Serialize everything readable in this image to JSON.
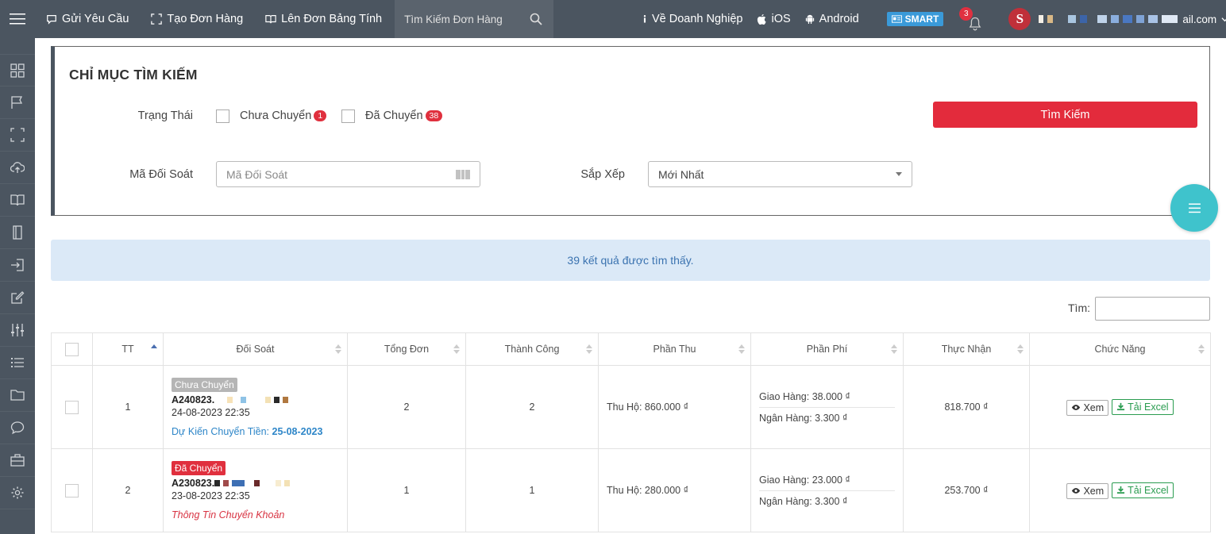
{
  "topbar": {
    "nav": [
      {
        "label": "Gửi Yêu Cầu",
        "icon": "chat-icon"
      },
      {
        "label": "Tạo Đơn Hàng",
        "icon": "scan-icon"
      },
      {
        "label": "Lên Đơn Bảng Tính",
        "icon": "book-icon"
      }
    ],
    "search_placeholder": "Tìm Kiếm Đơn Hàng",
    "about": "Về Doanh Nghiệp",
    "ios": "iOS",
    "android": "Android",
    "smart": "SMART",
    "notification_count": "3",
    "avatar_letter": "S",
    "email_suffix": "ail.com"
  },
  "filter": {
    "title": "CHỈ MỤC TÌM KIẾM",
    "status_label": "Trạng Thái",
    "option_pending": "Chưa Chuyển",
    "option_pending_count": "1",
    "option_done": "Đã Chuyển",
    "option_done_count": "38",
    "search_button": "Tìm Kiếm",
    "code_label": "Mã Đối Soát",
    "code_placeholder": "Mã Đối Soát",
    "sort_label": "Sắp Xếp",
    "sort_value": "Mới Nhất"
  },
  "result_text": "39 kết quả được tìm thấy.",
  "find_label": "Tìm:",
  "table": {
    "headers": [
      "TT",
      "Đối Soát",
      "Tổng Đơn",
      "Thành Công",
      "Phần Thu",
      "Phần Phí",
      "Thực Nhận",
      "Chức Năng"
    ],
    "rows": [
      {
        "index": "1",
        "status": "Chưa Chuyển",
        "code": "A240823.",
        "date": "24-08-2023 22:35",
        "note_label": "Dự Kiến Chuyển Tiền: ",
        "note_date": "25-08-2023",
        "total": "2",
        "success": "2",
        "income": "Thu Hộ: 860.000 ₫",
        "fee_ship": "Giao Hàng: 38.000 ₫",
        "fee_bank": "Ngân Hàng: 3.300 ₫",
        "net": "818.700 ₫",
        "view": "Xem",
        "excel": "Tải Excel"
      },
      {
        "index": "2",
        "status": "Đã Chuyển",
        "code": "A230823.",
        "date": "23-08-2023 22:35",
        "note_link": "Thông Tin Chuyển Khoản",
        "total": "1",
        "success": "1",
        "income": "Thu Hộ: 280.000 ₫",
        "fee_ship": "Giao Hàng: 23.000 ₫",
        "fee_bank": "Ngân Hàng: 3.300 ₫",
        "net": "253.700 ₫",
        "view": "Xem",
        "excel": "Tải Excel"
      }
    ]
  },
  "colors": {
    "topbar": "#4b5560",
    "accent_red": "#e32b3c",
    "fab": "#3fc3cc",
    "info_bar": "#dbe9f7"
  }
}
